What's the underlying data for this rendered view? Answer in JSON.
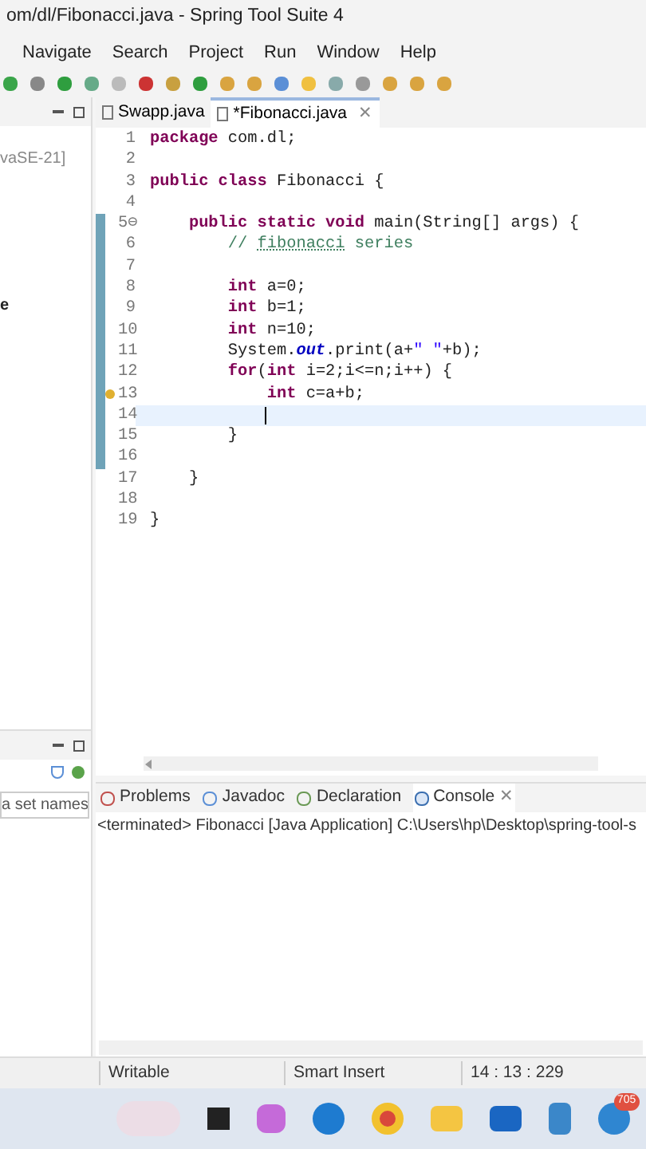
{
  "window": {
    "title": "om/dl/Fibonacci.java - Spring Tool Suite 4"
  },
  "menu": [
    "Navigate",
    "Search",
    "Project",
    "Run",
    "Window",
    "Help"
  ],
  "left_panel": {
    "items": [
      {
        "text": "vaSE-21]",
        "kind": "muted"
      },
      {
        "text": "e",
        "kind": "bold"
      }
    ]
  },
  "left_bottom_panel": {
    "filter_placeholder": "a set names"
  },
  "editor_tabs": [
    {
      "label": "Swapp.java",
      "selected": false
    },
    {
      "label": "*Fibonacci.java",
      "selected": true,
      "close": "✕"
    }
  ],
  "code": [
    {
      "number": "1",
      "changed": false,
      "warning": false,
      "current": false,
      "segments": [
        {
          "kind": "kw",
          "text": "package"
        },
        {
          "kind": "plain",
          "text": " com.dl;"
        }
      ]
    },
    {
      "number": "2",
      "changed": false,
      "warning": false,
      "current": false
    },
    {
      "number": "3",
      "changed": false,
      "warning": false,
      "current": false,
      "segments": [
        {
          "kind": "kw",
          "text": "public class"
        },
        {
          "kind": "plain",
          "text": " Fibonacci {"
        }
      ]
    },
    {
      "number": "4",
      "changed": false,
      "warning": false,
      "current": false
    },
    {
      "number": "5⊖",
      "changed": true,
      "warning": false,
      "current": false,
      "segments": [
        {
          "kind": "kw",
          "text": "    public static void"
        },
        {
          "kind": "plain",
          "text": " main(String[] args) {"
        }
      ]
    },
    {
      "number": "6",
      "changed": true,
      "warning": false,
      "current": false,
      "segments": [
        {
          "kind": "comment",
          "text": "        // "
        },
        {
          "kind": "spell",
          "text": "fibonacci"
        },
        {
          "kind": "comment",
          "text": " series"
        }
      ]
    },
    {
      "number": "7",
      "changed": true,
      "warning": false,
      "current": false
    },
    {
      "number": "8",
      "changed": true,
      "warning": false,
      "current": false,
      "segments": [
        {
          "kind": "kw",
          "text": "        int"
        },
        {
          "kind": "plain",
          "text": " a=0;"
        }
      ]
    },
    {
      "number": "9",
      "changed": true,
      "warning": false,
      "current": false,
      "segments": [
        {
          "kind": "kw",
          "text": "        int"
        },
        {
          "kind": "plain",
          "text": " b=1;"
        }
      ]
    },
    {
      "number": "10",
      "changed": true,
      "warning": false,
      "current": false,
      "segments": [
        {
          "kind": "kw",
          "text": "        int"
        },
        {
          "kind": "plain",
          "text": " n=10;"
        }
      ]
    },
    {
      "number": "11",
      "changed": true,
      "warning": false,
      "current": false,
      "segments": [
        {
          "kind": "plain",
          "text": "        System."
        },
        {
          "kind": "field",
          "text": "out"
        },
        {
          "kind": "plain",
          "text": ".print(a+"
        },
        {
          "kind": "string",
          "text": "\" \""
        },
        {
          "kind": "plain",
          "text": "+b);"
        }
      ]
    },
    {
      "number": "12",
      "changed": true,
      "warning": false,
      "current": false,
      "segments": [
        {
          "kind": "kw",
          "text": "        for"
        },
        {
          "kind": "plain",
          "text": "("
        },
        {
          "kind": "kw",
          "text": "int"
        },
        {
          "kind": "plain",
          "text": " i=2;i<=n;i++) {"
        }
      ]
    },
    {
      "number": "13",
      "changed": true,
      "warning": true,
      "current": false,
      "segments": [
        {
          "kind": "kw",
          "text": "            int"
        },
        {
          "kind": "plain",
          "text": " c=a+b;"
        }
      ]
    },
    {
      "number": "14",
      "changed": true,
      "warning": false,
      "current": true
    },
    {
      "number": "15",
      "changed": true,
      "warning": false,
      "current": false,
      "segments": [
        {
          "kind": "plain",
          "text": "        }"
        }
      ]
    },
    {
      "number": "16",
      "changed": true,
      "warning": false,
      "current": false
    },
    {
      "number": "17",
      "changed": false,
      "warning": false,
      "current": false,
      "segments": [
        {
          "kind": "plain",
          "text": "    }"
        }
      ]
    },
    {
      "number": "18",
      "changed": false,
      "warning": false,
      "current": false
    },
    {
      "number": "19",
      "changed": false,
      "warning": false,
      "current": false,
      "segments": [
        {
          "kind": "plain",
          "text": "}"
        }
      ]
    }
  ],
  "bottom_tabs": [
    {
      "label": "Problems",
      "kind": "problems",
      "selected": false
    },
    {
      "label": "Javadoc",
      "kind": "javadoc",
      "selected": false
    },
    {
      "label": "Declaration",
      "kind": "declaration",
      "selected": false
    },
    {
      "label": "Console",
      "kind": "console",
      "selected": true,
      "close": "✕"
    }
  ],
  "console": {
    "lines": [
      "<terminated> Fibonacci [Java Application] C:\\Users\\hp\\Desktop\\spring-tool-s"
    ]
  },
  "status_bar": [
    "Writable",
    "Smart Insert",
    "14 : 13 : 229"
  ],
  "taskbar": {
    "badge": "705"
  }
}
